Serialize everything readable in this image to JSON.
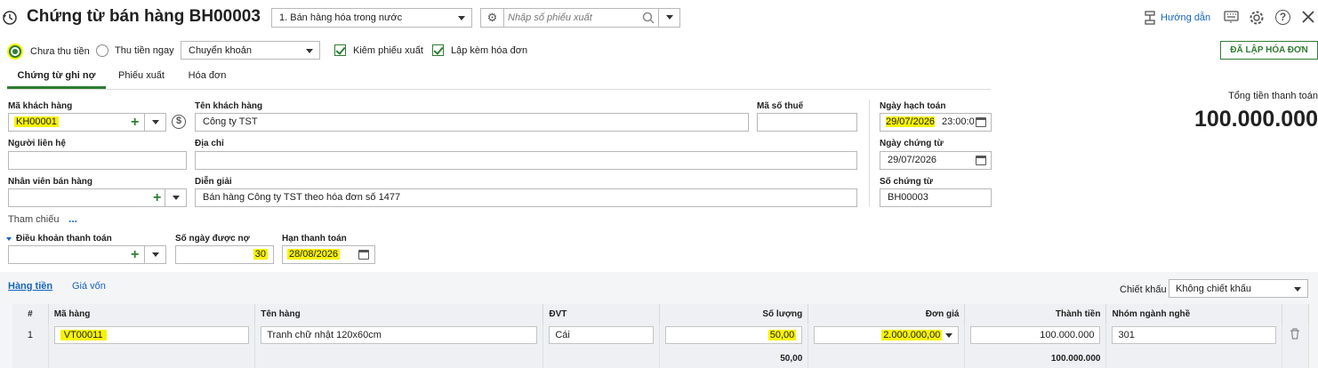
{
  "header": {
    "title": "Chứng từ bán hàng BH00003",
    "type_select": "1. Bán hàng hóa trong nước",
    "export_placeholder": "Nhập số phiếu xuất",
    "guide_label": "Hướng dẫn"
  },
  "options": {
    "unpaid_label": "Chưa thu tiền",
    "paid_label": "Thu tiền ngay",
    "payment_method": "Chuyển khoản",
    "check_export_label": "Kiêm phiếu xuất",
    "check_invoice_label": "Lập kèm hóa đơn",
    "status_button": "ĐÃ LẬP HÓA ĐƠN"
  },
  "tabs": [
    "Chứng từ ghi nợ",
    "Phiếu xuất",
    "Hóa đơn"
  ],
  "summary": {
    "total_label": "Tổng tiền thanh toán",
    "total_value": "100.000.000"
  },
  "form": {
    "customer_code_label": "Mã khách hàng",
    "customer_code": "KH00001",
    "customer_name_label": "Tên khách hàng",
    "customer_name": "Công ty TST",
    "tax_code_label": "Mã số thuế",
    "tax_code": "",
    "contact_label": "Người liên hệ",
    "contact": "",
    "address_label": "Địa chỉ",
    "address": "",
    "salesperson_label": "Nhân viên bán hàng",
    "salesperson": "",
    "description_label": "Diễn giải",
    "description": "Bán hàng Công ty TST theo hóa đơn số 1477",
    "reference_label": "Tham chiếu",
    "reference_more": "...",
    "posting_date_label": "Ngày hạch toán",
    "posting_date": "29/07/2026",
    "posting_time": "23:00:0",
    "voucher_date_label": "Ngày chứng từ",
    "voucher_date": "29/07/2026",
    "voucher_no_label": "Số chứng từ",
    "voucher_no": "BH00003",
    "payment_terms_label": "Điều khoản thanh toán",
    "payment_terms": "",
    "credit_days_label": "Số ngày được nợ",
    "credit_days": "30",
    "due_date_label": "Hạn thanh toán",
    "due_date": "28/08/2026"
  },
  "detail_tabs": {
    "goods": "Hàng tiền",
    "cost": "Giá vốn",
    "discount_label": "Chiết khấu",
    "discount_value": "Không chiết khấu"
  },
  "grid": {
    "headers": [
      "#",
      "Mã hàng",
      "Tên hàng",
      "ĐVT",
      "Số lượng",
      "Đơn giá",
      "Thành tiền",
      "Nhóm ngành nghề"
    ],
    "rows": [
      {
        "no": "1",
        "code": "VT00011",
        "name": "Tranh chữ nhật 120x60cm",
        "unit": "Cái",
        "qty": "50,00",
        "price": "2.000.000,00",
        "amount": "100.000.000",
        "industry": "301"
      }
    ],
    "footer": {
      "qty": "50,00",
      "amount": "100.000.000"
    }
  },
  "colors": {
    "accent": "#2e7d32",
    "highlight": "#f7f200",
    "link": "#1565c0"
  }
}
